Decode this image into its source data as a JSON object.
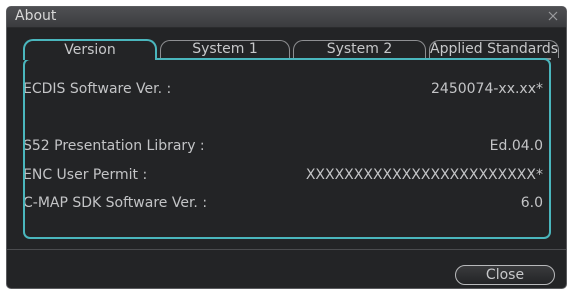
{
  "window": {
    "title": "About"
  },
  "tabs": [
    {
      "label": "Version",
      "active": true
    },
    {
      "label": "System 1",
      "active": false
    },
    {
      "label": "System 2",
      "active": false
    },
    {
      "label": "Applied Standards",
      "active": false
    }
  ],
  "info": {
    "rows": [
      {
        "label": "ECDIS Software Ver. :",
        "value": "2450074-xx.xx*"
      },
      {
        "label": "S52 Presentation Library :",
        "value": "Ed.04.0"
      },
      {
        "label": "ENC User Permit :",
        "value": "XXXXXXXXXXXXXXXXXXXXXXXX*"
      },
      {
        "label": "C-MAP SDK Software Ver. :",
        "value": "6.0"
      }
    ]
  },
  "footer": {
    "close_label": "Close"
  },
  "colors": {
    "background": "#232426",
    "accent": "#4ab6bd",
    "text": "#c3c4c6",
    "tab_border": "#8e8f92"
  },
  "icons": {
    "close": "close-icon"
  }
}
